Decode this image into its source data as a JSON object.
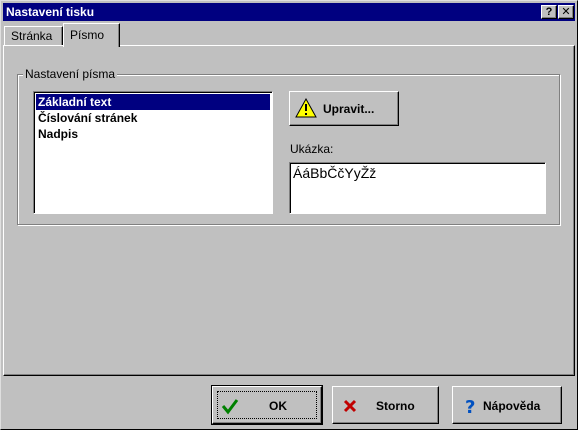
{
  "window": {
    "title": "Nastavení tisku",
    "help_button": "?",
    "close_button": "✕"
  },
  "tabs": [
    {
      "label": "Stránka",
      "active": false
    },
    {
      "label": "Písmo",
      "active": true
    }
  ],
  "font_settings": {
    "group_label": "Nastavení písma",
    "items": [
      {
        "label": "Základní text",
        "selected": true
      },
      {
        "label": "Číslování stránek",
        "selected": false
      },
      {
        "label": "Nadpis",
        "selected": false
      }
    ],
    "edit_button": {
      "label": "Upravit...",
      "icon": "warning-icon"
    },
    "preview_label": "Ukázka:",
    "preview_text": "ÁáBbČčYyŽž"
  },
  "footer": {
    "ok_label": "OK",
    "cancel_label": "Storno",
    "help_label": "Nápověda"
  },
  "colors": {
    "face": "#c0c0c0",
    "titlebar": "#000080",
    "selection": "#000080"
  }
}
